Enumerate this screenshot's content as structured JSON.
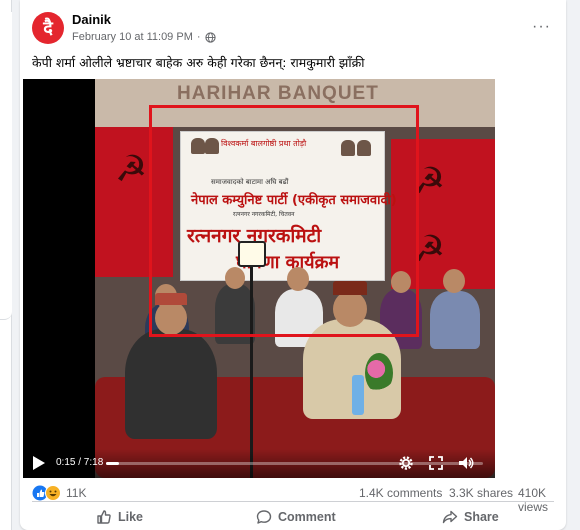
{
  "post": {
    "page_name": "Dainik",
    "avatar_letter": "दै",
    "timestamp": "February 10 at 11:09 PM",
    "more_label": "···",
    "caption": "केपी शर्मा ओलीले भ्रष्टाचार बाहेक अरु केही गरेका छैनन्: रामकुमारी झाँक्री"
  },
  "video_scene": {
    "background_sign": "HARIHAR BANQUET",
    "banner_line_1": "विश्वकर्मा बालगोष्ठी प्रथा तोड़ौ",
    "banner_line_2": "समाजवादको बाटामा अघि बढौं",
    "banner_line_3": "नेपाल कम्युनिष्ट पार्टी (एकीकृत समाजवादी)",
    "banner_line_4": "रत्ननगर नगरकमिटी, चितवन",
    "banner_line_5": "रत्ननगर नगरकमिटी",
    "banner_line_6": "घोषणा कार्यक्रम",
    "hammer_glyph": "☭"
  },
  "player": {
    "current_time": "0:15",
    "duration": "7:18",
    "time_display": "0:15 / 7:18",
    "progress_fraction": 0.034,
    "icons": [
      "play-icon",
      "settings-icon",
      "fullscreen-icon",
      "volume-icon"
    ]
  },
  "stats": {
    "reactions": "11K",
    "comments": "1.4K comments",
    "shares": "3.3K shares",
    "views": "410K views"
  },
  "actions": {
    "like": "Like",
    "comment": "Comment",
    "share": "Share"
  },
  "colors": {
    "accent_red": "#e0141c",
    "facebook_blue": "#1877f2",
    "muted_text": "#65676b"
  }
}
